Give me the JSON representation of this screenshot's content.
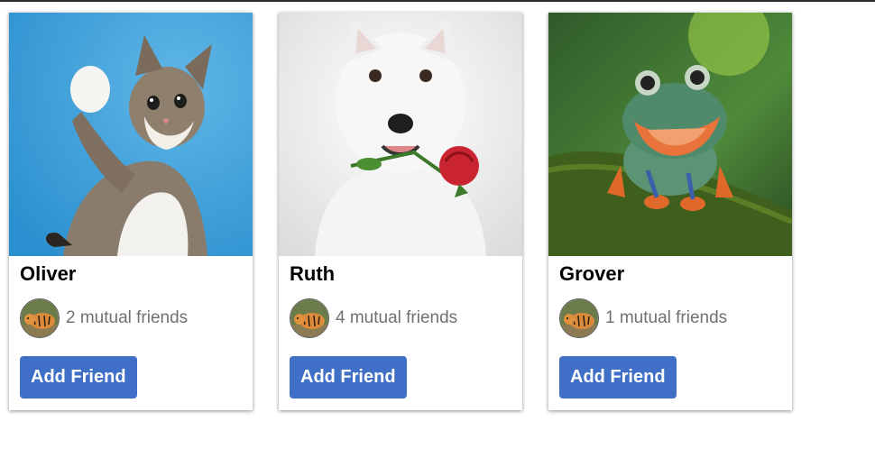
{
  "colors": {
    "button_bg": "#3f6fc6",
    "button_text": "#ffffff",
    "name_text": "#000000",
    "mutual_text": "#707070"
  },
  "cards": [
    {
      "name": "Oliver",
      "photo_icon": "cat-photo",
      "avatar_icon": "tiger-avatar",
      "mutual_friends": "2 mutual friends",
      "button_label": "Add Friend"
    },
    {
      "name": "Ruth",
      "photo_icon": "dog-photo",
      "avatar_icon": "tiger-avatar",
      "mutual_friends": "4 mutual friends",
      "button_label": "Add Friend"
    },
    {
      "name": "Grover",
      "photo_icon": "frog-photo",
      "avatar_icon": "tiger-avatar",
      "mutual_friends": "1 mutual friends",
      "button_label": "Add Friend"
    }
  ]
}
